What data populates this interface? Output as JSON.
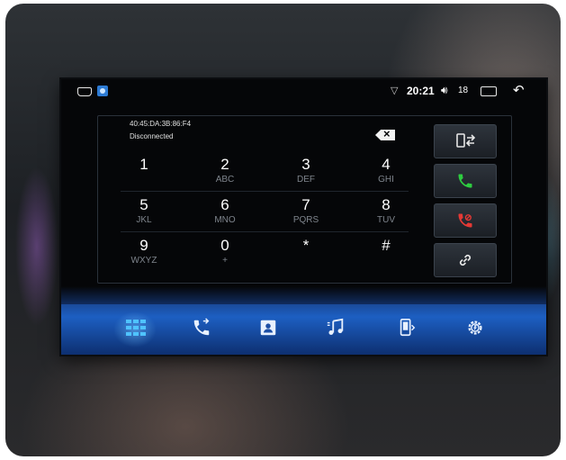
{
  "status_bar": {
    "time": "20:21",
    "volume": "18",
    "icons": [
      "home-icon",
      "app-icon",
      "wifi-icon",
      "volume-icon",
      "recent-apps-icon",
      "back-icon"
    ]
  },
  "dialer": {
    "device_address": "40:45:DA:3B:86:F4",
    "connection_status": "Disconnected",
    "keys": [
      {
        "digit": "1",
        "letters": ""
      },
      {
        "digit": "2",
        "letters": "ABC"
      },
      {
        "digit": "3",
        "letters": "DEF"
      },
      {
        "digit": "4",
        "letters": "GHI"
      },
      {
        "digit": "5",
        "letters": "JKL"
      },
      {
        "digit": "6",
        "letters": "MNO"
      },
      {
        "digit": "7",
        "letters": "PQRS"
      },
      {
        "digit": "8",
        "letters": "TUV"
      },
      {
        "digit": "9",
        "letters": "WXYZ"
      },
      {
        "digit": "0",
        "letters": "+"
      },
      {
        "digit": "*",
        "letters": ""
      },
      {
        "digit": "#",
        "letters": ""
      }
    ],
    "side_buttons": [
      "transfer-audio-icon",
      "call-icon",
      "hang-up-icon",
      "link-icon"
    ]
  },
  "bottom_nav": {
    "items": [
      "dialpad-icon",
      "call-log-icon",
      "contacts-icon",
      "music-icon",
      "phone-device-icon",
      "settings-icon"
    ],
    "active": "dialpad-icon"
  },
  "colors": {
    "accent": "#1d5fc2",
    "call_green": "#2ecc40",
    "hangup_red": "#e53935",
    "active_cyan": "#4fc3ff"
  }
}
